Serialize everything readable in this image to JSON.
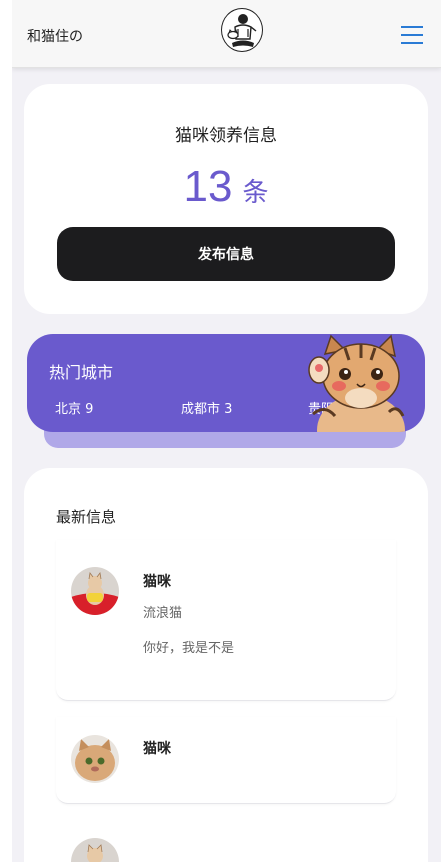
{
  "header": {
    "brand": "和猫住の",
    "logo_icon": "cat-person-logo-icon",
    "menu_icon": "hamburger-menu-icon"
  },
  "stats": {
    "title": "猫咪领养信息",
    "count": "13",
    "unit": "条",
    "publish_label": "发布信息"
  },
  "cities": {
    "title": "热门城市",
    "items": [
      {
        "label": "北京 9"
      },
      {
        "label": "成都市 3"
      },
      {
        "label": "贵阳市 1"
      }
    ]
  },
  "latest": {
    "title": "最新信息",
    "items": [
      {
        "name": "猫咪",
        "type": "流浪猫",
        "desc": "你好，我是不是"
      },
      {
        "name": "猫咪",
        "type": "",
        "desc": ""
      },
      {
        "name": "",
        "type": "",
        "desc": ""
      }
    ]
  },
  "colors": {
    "accent": "#6a5acd",
    "button": "#1c1c1e",
    "menu": "#2a7bd5",
    "background": "#f2f1f6"
  }
}
